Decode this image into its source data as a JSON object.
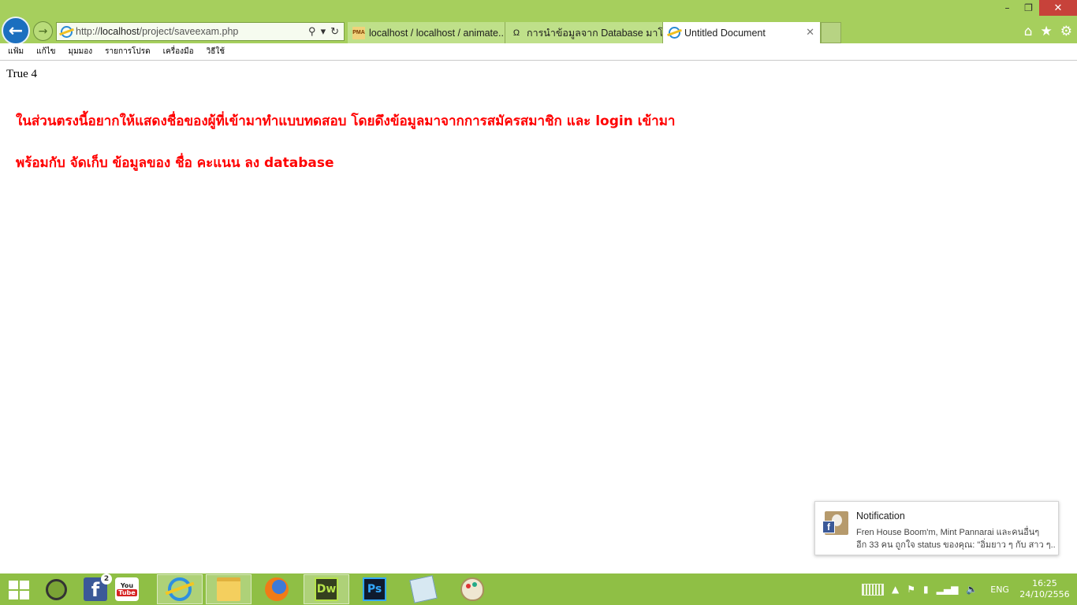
{
  "browser": {
    "address": {
      "scheme": "http://",
      "host": "localhost",
      "path": "/project/saveexam.php"
    },
    "tabs": [
      {
        "label": "localhost / localhost / animate...",
        "icon": "phpmyadmin-icon",
        "active": false
      },
      {
        "label": "การนำข้อมูลจาก Database มาโชว์ใ...",
        "icon": "forum-icon",
        "active": false
      },
      {
        "label": "Untitled Document",
        "icon": "ie-page-icon",
        "active": true
      }
    ],
    "window_controls": {
      "minimize": "–",
      "restore": "❐",
      "close": "✕"
    },
    "menu": [
      "แฟ้ม",
      "แก้ไข",
      "มุมมอง",
      "รายการโปรด",
      "เครื่องมือ",
      "วิธีใช้"
    ]
  },
  "page": {
    "echo": "True 4",
    "note_line1": "ในส่วนตรงนี้อยากให้แสดงชื่อของผู้ที่เข้ามาทำแบบทดสอบ โดยดึงข้อมูลมาจากการสมัครสมาชิก และ login เข้ามา",
    "note_line2": "พร้อมกับ จัดเก็บ ข้อมูลของ ชื่อ คะแนน ลง database",
    "note_color": "#ff0000"
  },
  "notification": {
    "title": "Notification",
    "line1": "Fren House Boom'm, Mint Pannarai และคนอื่นๆ",
    "line2": "อีก 33 คน ถูกใจ status ของคุณ: \"อิ่มยาว ๆ กับ สาว ๆ..."
  },
  "taskbar": {
    "facebook_badge": "2",
    "pinned": [
      "start-icon",
      "circle-app-icon",
      "facebook-icon",
      "youtube-icon",
      "internet-explorer-icon",
      "file-explorer-icon",
      "firefox-icon",
      "dreamweaver-icon",
      "photoshop-icon",
      "notepad-icon",
      "paint-icon"
    ],
    "dw_label": "Dw",
    "ps_label": "Ps",
    "yt_top": "You",
    "yt_bottom": "Tube",
    "language": "ENG",
    "time": "16:25",
    "date": "24/10/2556"
  },
  "colors": {
    "chrome": "#a6cf5d",
    "taskbar": "#8fbf45",
    "accent": "#1b6fbf"
  }
}
